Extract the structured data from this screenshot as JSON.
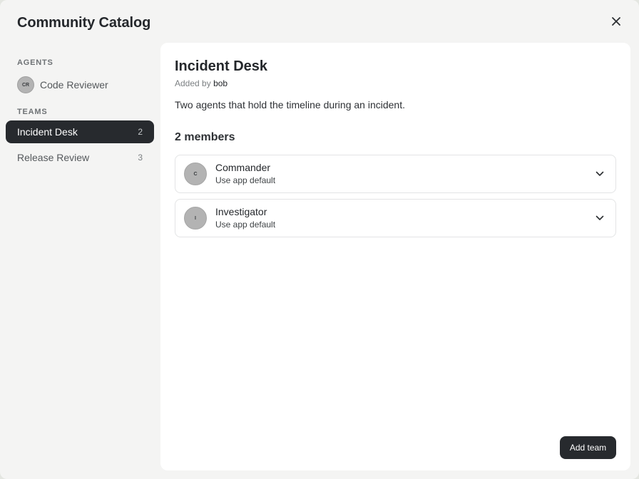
{
  "dialog": {
    "title": "Community Catalog",
    "close_icon": "close-icon"
  },
  "sidebar": {
    "agents_label": "AGENTS",
    "agents": [
      {
        "initials": "CR",
        "label": "Code Reviewer"
      }
    ],
    "teams_label": "TEAMS",
    "teams": [
      {
        "label": "Incident Desk",
        "count": "2",
        "active": true
      },
      {
        "label": "Release Review",
        "count": "3",
        "active": false
      }
    ]
  },
  "detail": {
    "title": "Incident Desk",
    "added_by_prefix": "Added by",
    "author": "bob",
    "description": "Two agents that hold the timeline during an incident.",
    "members_heading": "2 members",
    "members": [
      {
        "initial": "C",
        "name": "Commander",
        "model": "Use app default",
        "icon": "chevron-down-icon"
      },
      {
        "initial": "I",
        "name": "Investigator",
        "model": "Use app default",
        "icon": "chevron-down-icon"
      }
    ],
    "add_button_label": "Add team"
  },
  "colors": {
    "active_background": "#272a2e",
    "panel_background": "#ffffff",
    "dialog_background": "#f4f4f3",
    "avatar_background": "#b3b3b3"
  }
}
